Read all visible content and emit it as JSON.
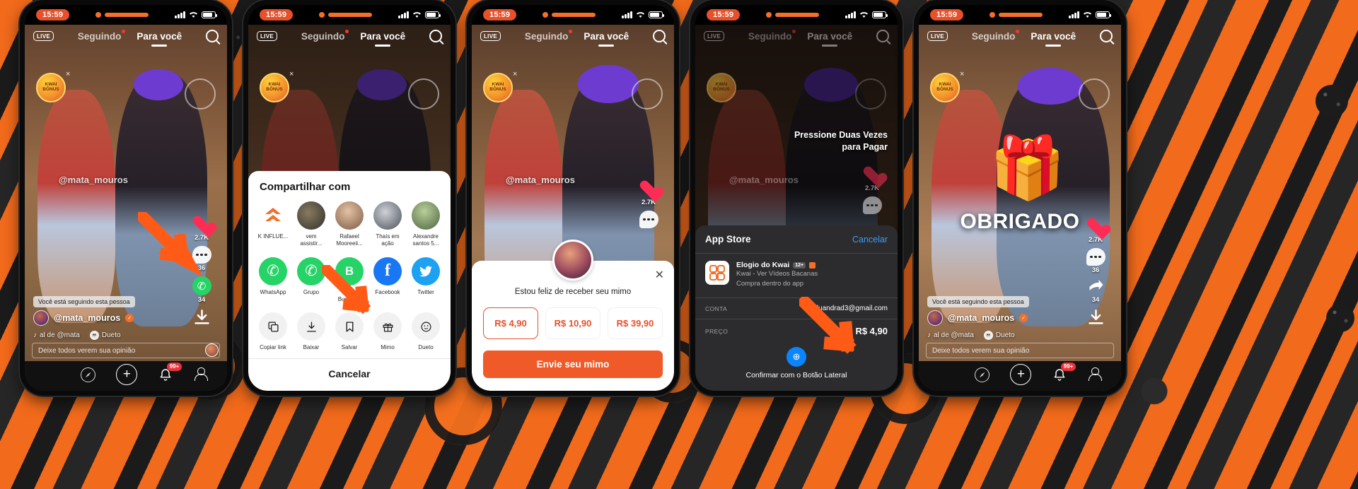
{
  "status_bar": {
    "time": "15:59"
  },
  "top_nav": {
    "live_label": "LIVE",
    "tab_following": "Seguindo",
    "tab_foryou": "Para você",
    "search_icon": "search-icon"
  },
  "bonus_badge": {
    "line1": "KWAI",
    "line2": "BÔNUS",
    "close": "×"
  },
  "video": {
    "handle_watermark": "@mata_mouros",
    "follow_chip": "Você está seguindo esta pessoa",
    "username": "@mata_mouros",
    "verified_glyph": "✓",
    "music_text": "al de @mata",
    "duet_text": "Dueto",
    "comment_placeholder": "Deixe todos verem sua opinião"
  },
  "rail": {
    "like_count": "2.7K",
    "comment_count": "36",
    "whatsapp_count": "34",
    "share_count": "34",
    "like_icon": "heart-icon",
    "comment_icon": "comment-icon",
    "whatsapp_icon": "whatsapp-icon",
    "share_icon": "share-arrow-icon",
    "download_icon": "download-icon"
  },
  "bottom_nav": {
    "home_icon": "home-icon",
    "discover_icon": "compass-icon",
    "create_icon": "plus-icon",
    "notifications_icon": "bell-icon",
    "notifications_badge": "99+",
    "profile_icon": "person-icon"
  },
  "share_sheet": {
    "title": "Compartilhar com",
    "contacts": [
      {
        "name": "K INFLUE...",
        "icon": "kwai-logo-icon"
      },
      {
        "name": "vem assistir...",
        "icon": "avatar"
      },
      {
        "name": "Rafaeel Mooreeii...",
        "icon": "avatar"
      },
      {
        "name": "Thaís em ação",
        "icon": "avatar"
      },
      {
        "name": "Alexandre santos 5...",
        "icon": "avatar"
      }
    ],
    "apps": [
      {
        "name": "WhatsApp",
        "icon": "whatsapp-icon",
        "color": "#25d366"
      },
      {
        "name": "Grupo",
        "icon": "whatsapp-group-icon",
        "color": "#25d366"
      },
      {
        "name": "Whats Business",
        "icon": "whatsapp-business-icon",
        "color": "#25d366"
      },
      {
        "name": "Facebook",
        "icon": "facebook-icon",
        "color": "#1877f2"
      },
      {
        "name": "Twitter",
        "icon": "twitter-icon",
        "color": "#1da1f2"
      }
    ],
    "actions": [
      {
        "name": "Copiar link",
        "icon": "copy-icon"
      },
      {
        "name": "Baixar",
        "icon": "download-icon"
      },
      {
        "name": "Salvar",
        "icon": "bookmark-icon"
      },
      {
        "name": "Mimo",
        "icon": "gift-icon"
      },
      {
        "name": "Dueto",
        "icon": "duet-icon"
      }
    ],
    "cancel_label": "Cancelar"
  },
  "mimo_sheet": {
    "close_glyph": "✕",
    "message": "Estou feliz de receber seu mimo",
    "prices": [
      "R$ 4,90",
      "R$ 10,90",
      "R$ 39,90"
    ],
    "selected_price": "R$ 4,90",
    "send_label": "Envie seu mimo"
  },
  "app_store": {
    "title": "App Store",
    "cancel_label": "Cancelar",
    "app_name": "Elogio do Kwai",
    "age_rating": "12+",
    "app_subtitle": "Kwai - Ver Vídeos Bacanas",
    "app_note": "Compra dentro do app",
    "account_key": "CONTA",
    "account_value": "kaduandrad3@gmail.com",
    "price_key": "PREÇO",
    "price_value": "R$ 4,90",
    "confirm_label": "Confirmar com o Botão Lateral",
    "double_press_hint": "Pressione Duas Vezes\npara Pagar",
    "double_press_line1": "Pressione Duas Vezes",
    "double_press_line2": "para Pagar"
  },
  "thank_you": {
    "gift_icon": "gift-box-icon",
    "text": "OBRIGADO"
  },
  "colors": {
    "accent_orange": "#f2702a",
    "send_button": "#ef5a28",
    "like_red": "#fe2c55",
    "whatsapp_green": "#25d366",
    "ios_blue": "#3b9bfd",
    "arrow_orange": "#ff5b16"
  }
}
